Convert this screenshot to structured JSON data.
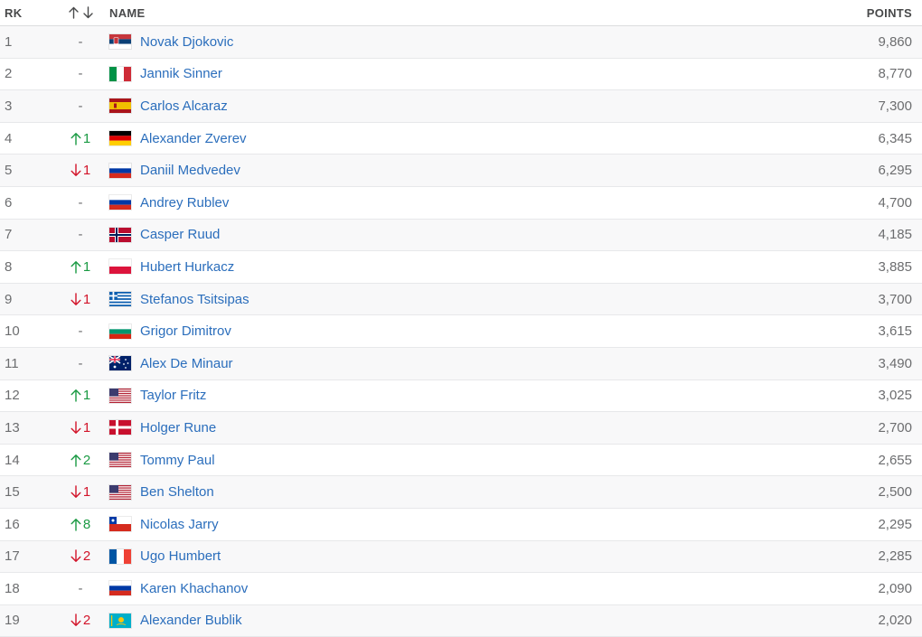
{
  "header": {
    "rank_label": "RK",
    "move_icons": [
      "arrow-up-icon",
      "arrow-down-icon"
    ],
    "name_label": "NAME",
    "points_label": "POINTS"
  },
  "colors": {
    "link": "#2b6ebc",
    "up": "#1a9a43",
    "down": "#d2142a"
  },
  "rows": [
    {
      "rank": "1",
      "dir": "none",
      "move": "-",
      "country": "Serbia",
      "name": "Novak Djokovic",
      "points": "9,860"
    },
    {
      "rank": "2",
      "dir": "none",
      "move": "-",
      "country": "Italy",
      "name": "Jannik Sinner",
      "points": "8,770"
    },
    {
      "rank": "3",
      "dir": "none",
      "move": "-",
      "country": "Spain",
      "name": "Carlos Alcaraz",
      "points": "7,300"
    },
    {
      "rank": "4",
      "dir": "up",
      "move": "1",
      "country": "Germany",
      "name": "Alexander Zverev",
      "points": "6,345"
    },
    {
      "rank": "5",
      "dir": "down",
      "move": "1",
      "country": "Russia",
      "name": "Daniil Medvedev",
      "points": "6,295"
    },
    {
      "rank": "6",
      "dir": "none",
      "move": "-",
      "country": "Russia",
      "name": "Andrey Rublev",
      "points": "4,700"
    },
    {
      "rank": "7",
      "dir": "none",
      "move": "-",
      "country": "Norway",
      "name": "Casper Ruud",
      "points": "4,185"
    },
    {
      "rank": "8",
      "dir": "up",
      "move": "1",
      "country": "Poland",
      "name": "Hubert Hurkacz",
      "points": "3,885"
    },
    {
      "rank": "9",
      "dir": "down",
      "move": "1",
      "country": "Greece",
      "name": "Stefanos Tsitsipas",
      "points": "3,700"
    },
    {
      "rank": "10",
      "dir": "none",
      "move": "-",
      "country": "Bulgaria",
      "name": "Grigor Dimitrov",
      "points": "3,615"
    },
    {
      "rank": "11",
      "dir": "none",
      "move": "-",
      "country": "Australia",
      "name": "Alex De Minaur",
      "points": "3,490"
    },
    {
      "rank": "12",
      "dir": "up",
      "move": "1",
      "country": "USA",
      "name": "Taylor Fritz",
      "points": "3,025"
    },
    {
      "rank": "13",
      "dir": "down",
      "move": "1",
      "country": "Denmark",
      "name": "Holger Rune",
      "points": "2,700"
    },
    {
      "rank": "14",
      "dir": "up",
      "move": "2",
      "country": "USA",
      "name": "Tommy Paul",
      "points": "2,655"
    },
    {
      "rank": "15",
      "dir": "down",
      "move": "1",
      "country": "USA",
      "name": "Ben Shelton",
      "points": "2,500"
    },
    {
      "rank": "16",
      "dir": "up",
      "move": "8",
      "country": "Chile",
      "name": "Nicolas Jarry",
      "points": "2,295"
    },
    {
      "rank": "17",
      "dir": "down",
      "move": "2",
      "country": "France",
      "name": "Ugo Humbert",
      "points": "2,285"
    },
    {
      "rank": "18",
      "dir": "none",
      "move": "-",
      "country": "Russia",
      "name": "Karen Khachanov",
      "points": "2,090"
    },
    {
      "rank": "19",
      "dir": "down",
      "move": "2",
      "country": "Kazakhstan",
      "name": "Alexander Bublik",
      "points": "2,020"
    }
  ]
}
